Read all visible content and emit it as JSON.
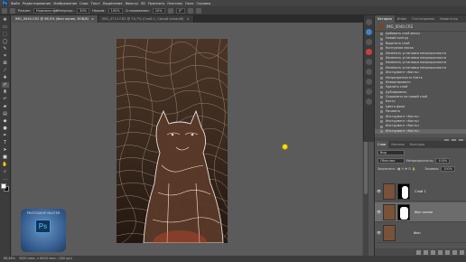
{
  "menubar": {
    "logo": "Ps",
    "items": [
      "Файл",
      "Редактирование",
      "Изображение",
      "Слои",
      "Текст",
      "Выделение",
      "Фильтр",
      "3D",
      "Просмотр",
      "Плагины",
      "Окно",
      "Справка"
    ]
  },
  "options": {
    "mode_label": "Режим:",
    "mode_value": "Нормальный",
    "opacity_label": "Непрозр.:",
    "opacity_value": "30%",
    "flow_label": "Нажим:",
    "flow_value": "100%",
    "smooth_label": "Сглаживание:",
    "smooth_value": "10%",
    "angle_value": "0°"
  },
  "tabs": [
    {
      "label": "IMG_0040.CR2 @ 66,5% (Фон копия, RGB/8)",
      "active": true,
      "close": "×"
    },
    {
      "label": "IMG_4712.CR2 @ 74,7% (Слой 1, Синий канал/8)",
      "active": false,
      "close": "×"
    }
  ],
  "canvas": {
    "watermark_text": "PHOTOSHOP MASTER",
    "watermark_logo": "Ps"
  },
  "status": {
    "zoom": "66,46%",
    "doc": "3000 пикс. x 6000 пикс. (300 ppi)"
  },
  "history": {
    "tabs": [
      "История",
      "Инфо",
      "Гистограмма",
      "Навигатор"
    ],
    "snapshot": "IMG_0040.CR2",
    "items": [
      "Добавить слой-маску",
      "Новый контур",
      "Вырезать слой",
      "Контурная маска",
      "Изменить установки непрозрачности",
      "Изменить установки непрозрачности",
      "Изменить установки непрозрачности",
      "Изменить установки непрозрачности",
      "Инструмент «Кисть»",
      "Непрозрачность Кисть",
      "Инвертировать",
      "Удалить слой",
      "Дублировать",
      "Сохранить на новый слой",
      "Кисть",
      "Цвета фона",
      "Рисовать",
      "Инструмент «Кисть»",
      "Инструмент «Кисть»",
      "Инструмент «Кисть»",
      "Инструмент «Кисть»"
    ]
  },
  "layers": {
    "tabs": [
      "Слои",
      "Каналы",
      "Контуры"
    ],
    "filter": "Вид",
    "blend": "Обычные",
    "opacity_label": "Непрозрачность:",
    "opacity": "100%",
    "lock_label": "Закрепить:",
    "fill_label": "Заливка:",
    "fill": "100%",
    "items": [
      {
        "name": "Слой 1",
        "selected": false
      },
      {
        "name": "Фон копия",
        "selected": true
      },
      {
        "name": "Фон",
        "selected": false
      }
    ],
    "eye": "👁"
  }
}
